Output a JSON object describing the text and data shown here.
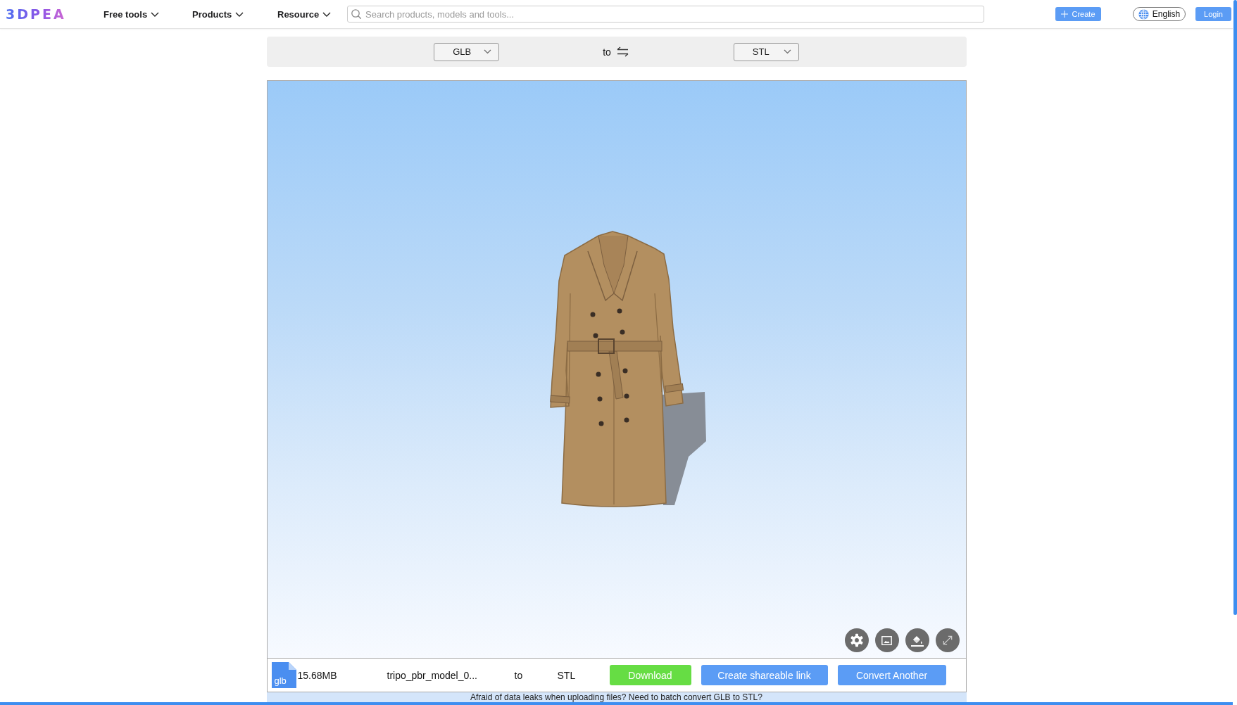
{
  "header": {
    "logo": "3DPEA",
    "nav": [
      {
        "label": "Free tools"
      },
      {
        "label": "Products"
      },
      {
        "label": "Resource"
      }
    ],
    "search": {
      "placeholder": "Search products, models and tools..."
    },
    "create_button": "Create",
    "language": "English",
    "login_button": "Login"
  },
  "converter": {
    "from": "GLB",
    "separator": "to",
    "to": "STL"
  },
  "viewer": {
    "controls": [
      {
        "kind": "settings"
      },
      {
        "kind": "background"
      },
      {
        "kind": "paint"
      },
      {
        "kind": "fullscreen"
      }
    ],
    "file": {
      "type": "glb",
      "size": "15.68MB",
      "name": "tripo_pbr_model_0...",
      "separator": "to",
      "target": "STL"
    },
    "actions": [
      {
        "label": "Download",
        "kind": "primary"
      },
      {
        "label": "Create shareable link",
        "kind": "secondary"
      },
      {
        "label": "Convert Another",
        "kind": "secondary"
      }
    ]
  },
  "faq": {
    "heading": "Afraid of data leaks when uploading files? Need to batch convert GLB to STL?"
  }
}
